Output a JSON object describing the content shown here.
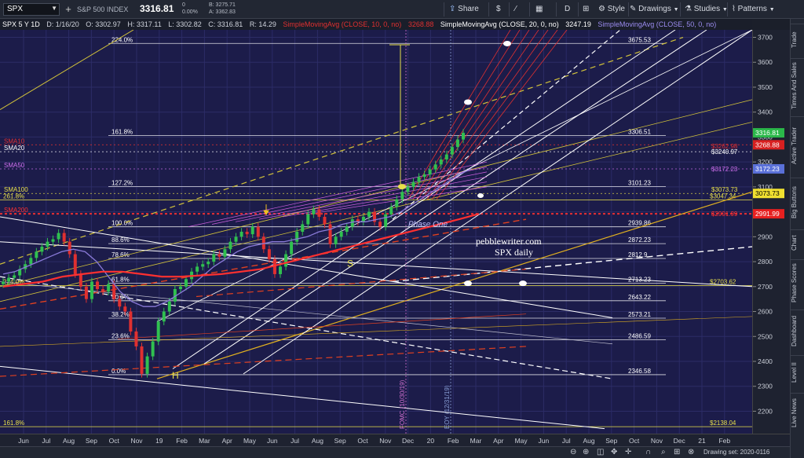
{
  "toolbar": {
    "symbol": "SPX",
    "description": "S&P 500 INDEX",
    "last": "3316.81",
    "change": "0",
    "change_pct": "0.00%",
    "bid": "B: 3275.71",
    "ask": "A: 3362.83",
    "share": "Share",
    "period": "D",
    "style": "Style",
    "drawings": "Drawings",
    "studies": "Studies",
    "patterns": "Patterns"
  },
  "infoline": {
    "symbol": "SPX 5 Y 1D",
    "date": "D: 1/16/20",
    "open": "O: 3302.97",
    "high": "H: 3317.11",
    "low": "L: 3302.82",
    "close": "C: 3316.81",
    "range": "R: 14.29",
    "sma10_label": "SimpleMovingAvg (CLOSE, 10, 0, no)",
    "sma10_value": "3268.88",
    "sma20_label": "SimpleMovingAvg (CLOSE, 20, 0, no)",
    "sma20_value": "3247.19",
    "sma50_label": "SimpleMovingAvg (CLOSE, 50, 0, no)"
  },
  "chart_data": {
    "type": "candlestick",
    "title": "SPX daily",
    "watermark": "pebblewriter.com",
    "ylim": [
      2110,
      3730
    ],
    "price_ticks": [
      2200,
      2300,
      2400,
      2500,
      2600,
      2700,
      2800,
      2900,
      3000,
      3100,
      3200,
      3300,
      3400,
      3500,
      3600,
      3700
    ],
    "time_ticks": [
      "Jun",
      "Jul",
      "Aug",
      "Sep",
      "Oct",
      "Nov",
      "19",
      "Feb",
      "Mar",
      "Apr",
      "May",
      "Jun",
      "Jul",
      "Aug",
      "Sep",
      "Oct",
      "Nov",
      "Dec",
      "20",
      "Feb",
      "Mar",
      "Apr",
      "May",
      "Jun",
      "Jul",
      "Aug",
      "Sep",
      "Oct",
      "Nov",
      "Dec",
      "21",
      "Feb"
    ],
    "fib_levels": [
      {
        "label": "224.0%",
        "value": 3675.53,
        "price_label": "3675.53"
      },
      {
        "label": "161.8%",
        "value": 3306.51,
        "price_label": "3306.51"
      },
      {
        "label": "127.2%",
        "value": 3101.23,
        "price_label": "3101.23"
      },
      {
        "label": "100.0%",
        "value": 2939.86,
        "price_label": "2939.86"
      },
      {
        "label": "88.6%",
        "value": 2872.23,
        "price_label": "2872.23"
      },
      {
        "label": "78.6%",
        "value": 2812.9,
        "price_label": "2812.9"
      },
      {
        "label": "61.8%",
        "value": 2713.23,
        "price_label": "2713.23"
      },
      {
        "label": "50.0%",
        "value": 2643.22,
        "price_label": "2643.22"
      },
      {
        "label": "38.2%",
        "value": 2573.21,
        "price_label": "2573.21"
      },
      {
        "label": "23.6%",
        "value": 2486.59,
        "price_label": "2486.59"
      },
      {
        "label": "0.0%",
        "value": 2346.58,
        "price_label": "2346.58"
      }
    ],
    "extra_levels": [
      {
        "label": "161.8%",
        "value": 2138.04,
        "price_label": "$2138.04",
        "color": "#e8e04a"
      },
      {
        "label": "224.0%",
        "value": 2703.62,
        "price_label": "$2703.62",
        "color": "#e8e04a"
      },
      {
        "label": "261.8%",
        "value": 3047.34,
        "price_label": "$3047.34",
        "color": "#e8e04a"
      }
    ],
    "ma_levels": [
      {
        "label": "SMA10",
        "value": 3268.88,
        "price_label": "3268.88",
        "color": "#e03030"
      },
      {
        "label": "SMA20",
        "value": 3240.97,
        "price_label": "$3240.97",
        "color": "#ffffff"
      },
      {
        "label": "SMA50",
        "value": 3172.23,
        "price_label": "$3172.23",
        "color": "#d070f0"
      },
      {
        "label": "SMA100",
        "value": 3073.73,
        "price_label": "$3073.73",
        "color": "#e8e04a"
      },
      {
        "label": "SMA200",
        "value": 2991.99,
        "price_label": "$2991.99",
        "color": "#ff3030"
      }
    ],
    "overlaps": {
      "sma10_right": "$3262.98"
    },
    "axis_badges": [
      {
        "value": 3316.81,
        "label": "3316.81",
        "bg": "#2bb84a",
        "fg": "#ffffff"
      },
      {
        "value": 3268.88,
        "label": "3268.88",
        "bg": "#d82020",
        "fg": "#ffffff"
      },
      {
        "value": 3172.23,
        "label": "3172.23",
        "bg": "#5a70d8",
        "fg": "#ffffff"
      },
      {
        "value": 3073.73,
        "label": "3073.73",
        "bg": "#f0e030",
        "fg": "#000000"
      },
      {
        "value": 2991.99,
        "label": "2991.99",
        "bg": "#e82020",
        "fg": "#ffffff"
      }
    ],
    "annotations": {
      "phase_one": "Phase One",
      "h_label": "H",
      "s_label": "S",
      "fomc": "FOMC (10/30/19)",
      "eoy": "EOY (12/31/19)"
    },
    "price_series": [
      2720,
      2735,
      2745,
      2770,
      2790,
      2815,
      2840,
      2860,
      2880,
      2890,
      2915,
      2880,
      2830,
      2750,
      2700,
      2650,
      2720,
      2690,
      2680,
      2710,
      2650,
      2620,
      2600,
      2520,
      2460,
      2350,
      2420,
      2480,
      2560,
      2600,
      2640,
      2690,
      2700,
      2730,
      2760,
      2780,
      2790,
      2800,
      2830,
      2820,
      2850,
      2880,
      2900,
      2920,
      2910,
      2940,
      2900,
      2850,
      2810,
      2750,
      2780,
      2830,
      2880,
      2920,
      2950,
      2990,
      3010,
      2980,
      2950,
      2870,
      2900,
      2920,
      2940,
      2970,
      2960,
      2980,
      3000,
      2960,
      2940,
      2990,
      3020,
      3050,
      3080,
      3100,
      3120,
      3140,
      3150,
      3170,
      3190,
      3210,
      3230,
      3260,
      3290,
      3316.81
    ],
    "price_series_start_month": "Jun 2018",
    "price_series_end_date": "1/16/20",
    "sma50_series": [
      2750,
      2760,
      2780,
      2800,
      2820,
      2840,
      2850,
      2840,
      2800,
      2740,
      2680,
      2640,
      2620,
      2620,
      2640,
      2670,
      2700,
      2740,
      2780,
      2810,
      2840,
      2860,
      2870,
      2880,
      2880,
      2890,
      2900,
      2920,
      2930,
      2950,
      2960,
      2960,
      2970,
      2980,
      3000,
      3030,
      3060,
      3090,
      3120,
      3150,
      3172.23
    ],
    "sma200_series": [
      2700,
      2710,
      2720,
      2740,
      2750,
      2760,
      2760,
      2750,
      2740,
      2740,
      2745,
      2750,
      2760,
      2770,
      2790,
      2810,
      2830,
      2850,
      2870,
      2890,
      2910,
      2930,
      2950,
      2970,
      2991.99
    ]
  },
  "time_axis_extra": {
    "jun": "Jun"
  },
  "sidebar": {
    "tabs": [
      "Trade",
      "Times And Sales",
      "Active Trader",
      "Big Buttons",
      "Chart",
      "Phase Scores",
      "Dashboard",
      "Level II",
      "Live News"
    ]
  },
  "bottombar": {
    "drawing_set": "Drawing set: 2020-0116"
  },
  "colors": {
    "background": "#1c1c4a",
    "fib_line": "#ffffff",
    "up_candle": "#30c050",
    "down_candle": "#e03030",
    "sma10": "#e03030",
    "sma20": "#ffffff",
    "sma50": "#8a7ad8",
    "sma100": "#e8e04a",
    "sma200": "#ff3030",
    "trend_yellow": "#d4c43a",
    "trend_white": "#ffffff"
  }
}
